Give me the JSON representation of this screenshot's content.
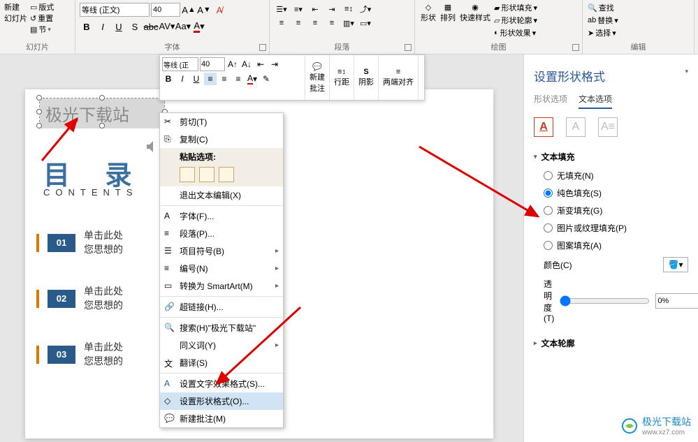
{
  "ribbon": {
    "slides": {
      "label": "幻灯片",
      "new_slide": "新建\n幻灯片",
      "layout": "版式",
      "reset": "重置",
      "section": "节"
    },
    "font": {
      "label": "字体",
      "font_name": "等线 (正文)",
      "font_size": "40"
    },
    "paragraph": {
      "label": "段落"
    },
    "drawing": {
      "label": "绘图",
      "shapes": "形状",
      "arrange": "排列",
      "quick_styles": "快速样式",
      "shape_fill": "形状填充",
      "shape_outline": "形状轮廓",
      "shape_effects": "形状效果"
    },
    "editing": {
      "label": "编辑",
      "find": "查找",
      "replace": "替换",
      "select": "选择"
    }
  },
  "mini": {
    "font_name": "等线 (正",
    "font_size": "40",
    "new_comment": "新建\n批注",
    "line_spacing": "行距",
    "shadow": "阴影",
    "justify": "两端对齐"
  },
  "slide": {
    "textbox_text": "极光下载站",
    "title": "目 录",
    "subtitle": "CONTENTS",
    "items": [
      {
        "num": "01",
        "t1": "单击此处",
        "t2": "您思想的"
      },
      {
        "num": "02",
        "t1": "单击此处",
        "t2": "您思想的"
      },
      {
        "num": "03",
        "t1": "单击此处",
        "t2": "您思想的"
      }
    ]
  },
  "context_menu": {
    "cut": "剪切(T)",
    "copy": "复制(C)",
    "paste_label": "粘贴选项:",
    "exit_text": "退出文本编辑(X)",
    "font": "字体(F)...",
    "paragraph": "段落(P)...",
    "bullets": "项目符号(B)",
    "numbering": "编号(N)",
    "smartart": "转换为 SmartArt(M)",
    "hyperlink": "超链接(H)...",
    "search": "搜索(H)\"极光下载站\"",
    "synonyms": "同义词(Y)",
    "translate": "翻译(S)",
    "text_effects": "设置文字效果格式(S)...",
    "shape_format": "设置形状格式(O)...",
    "new_comment": "新建批注(M)"
  },
  "panel": {
    "title": "设置形状格式",
    "tab_shape": "形状选项",
    "tab_text": "文本选项",
    "section_fill": "文本填充",
    "fill_none": "无填充(N)",
    "fill_solid": "纯色填充(S)",
    "fill_gradient": "渐变填充(G)",
    "fill_picture": "图片或纹理填充(P)",
    "fill_pattern": "图案填充(A)",
    "color_label": "颜色(C)",
    "transparency_label": "透明度(T)",
    "transparency_value": "0%",
    "section_outline": "文本轮廓"
  },
  "watermark": {
    "name": "极光下载站",
    "url": "www.xz7.com"
  }
}
